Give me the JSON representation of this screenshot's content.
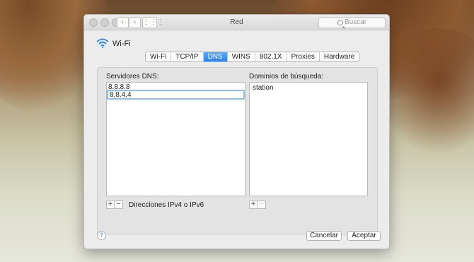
{
  "window": {
    "title": "Red",
    "search_placeholder": "Buscar"
  },
  "interface": {
    "name": "Wi-Fi",
    "icon": "wifi-icon"
  },
  "tabs": [
    {
      "label": "Wi-Fi",
      "active": false
    },
    {
      "label": "TCP/IP",
      "active": false
    },
    {
      "label": "DNS",
      "active": true
    },
    {
      "label": "WINS",
      "active": false
    },
    {
      "label": "802.1X",
      "active": false
    },
    {
      "label": "Proxies",
      "active": false
    },
    {
      "label": "Hardware",
      "active": false
    }
  ],
  "dns": {
    "servers_label": "Servidores DNS:",
    "servers": [
      "8.8.8.8",
      "8.8.4.4"
    ],
    "hint": "Direcciones IPv4 o IPv6"
  },
  "search_domains": {
    "label": "Dominios de búsqueda:",
    "items": [
      "station"
    ]
  },
  "buttons": {
    "help": "?",
    "cancel": "Cancelar",
    "accept": "Aceptar",
    "add": "+",
    "remove": "−"
  },
  "colors": {
    "accent": "#2d83f0"
  }
}
